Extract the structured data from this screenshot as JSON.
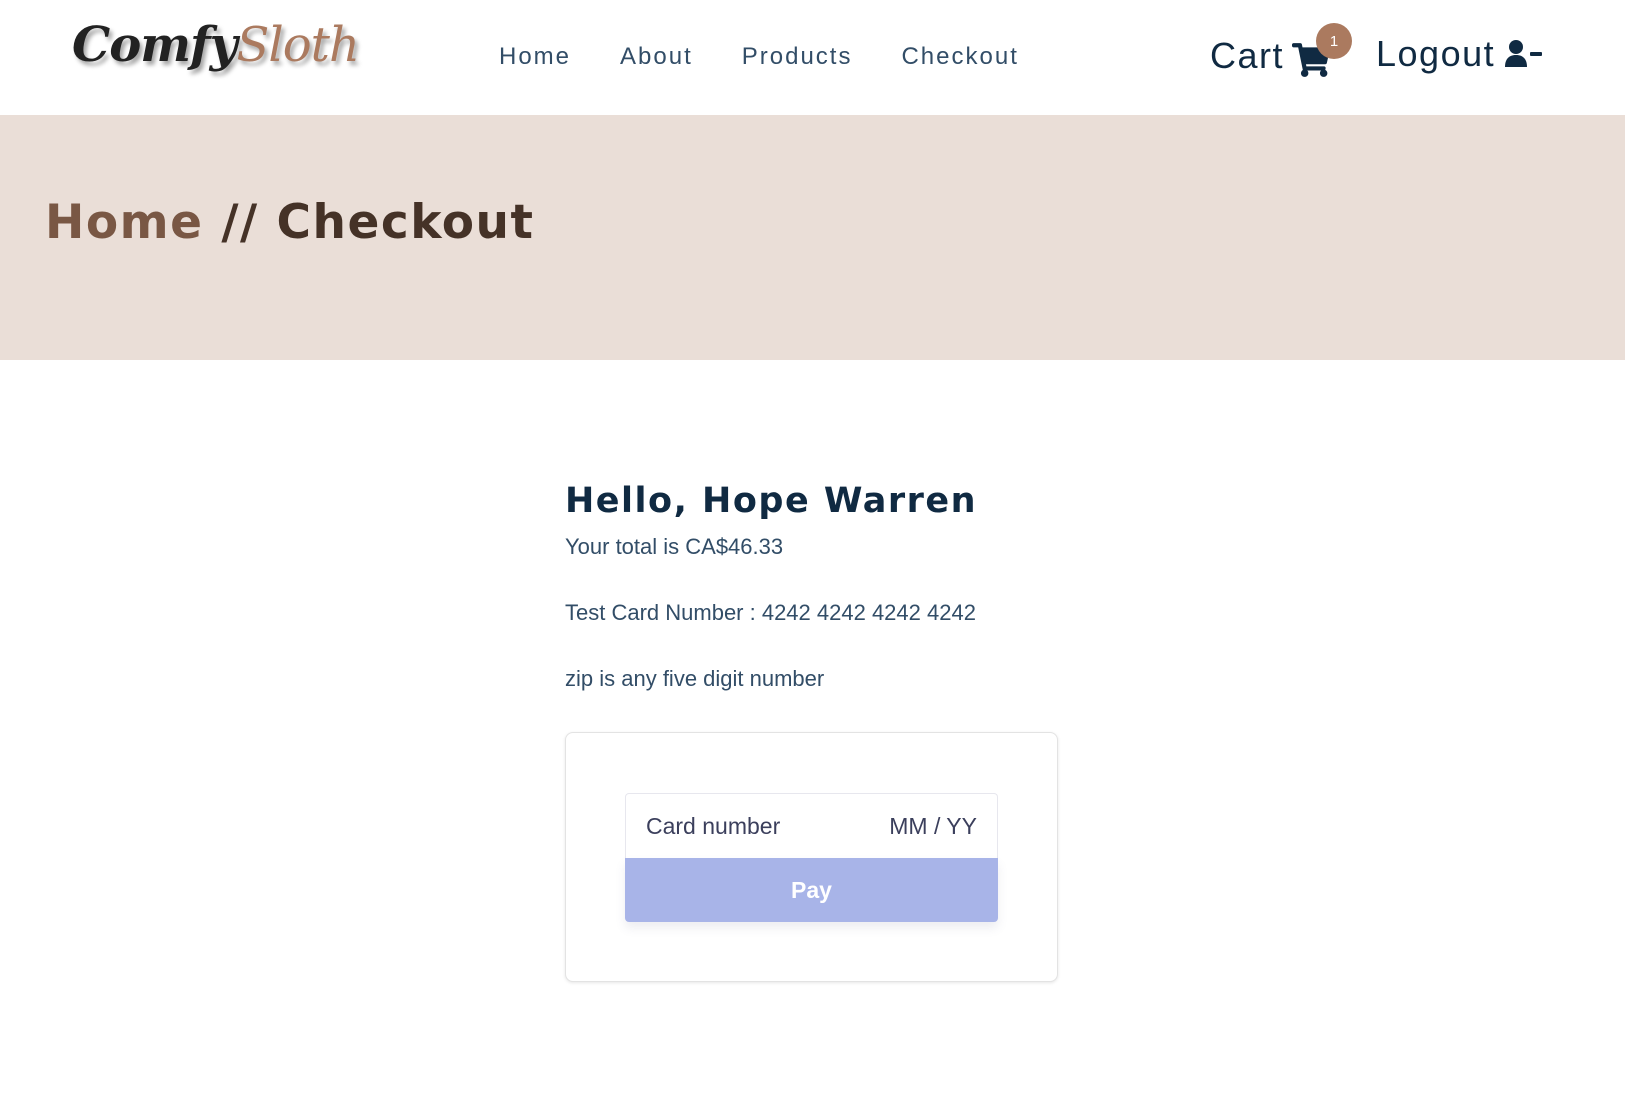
{
  "brand": {
    "name_part1": "Comfy",
    "name_part2": "Sloth",
    "accent_color": "#ab7a5f",
    "hero_bg_color": "#eaded7"
  },
  "nav": {
    "links": [
      {
        "label": "Home"
      },
      {
        "label": "About"
      },
      {
        "label": "Products"
      },
      {
        "label": "Checkout"
      }
    ],
    "cart_label": "Cart",
    "cart_icon": "shopping-cart-icon",
    "cart_count": "1",
    "logout_label": "Logout",
    "logout_icon": "user-minus-icon"
  },
  "hero": {
    "breadcrumb_home": "Home",
    "breadcrumb_separator": " // ",
    "breadcrumb_current": "Checkout"
  },
  "checkout": {
    "greeting": "Hello, Hope Warren",
    "total_text": "Your total is CA$46.33",
    "test_card_text": "Test Card Number : 4242 4242 4242 4242",
    "zip_text": "zip is any five digit number"
  },
  "payment_form": {
    "card_number_placeholder": "Card number",
    "expiry_placeholder": "MM / YY",
    "pay_label": "Pay",
    "pay_button_color": "#a8b4e8"
  }
}
